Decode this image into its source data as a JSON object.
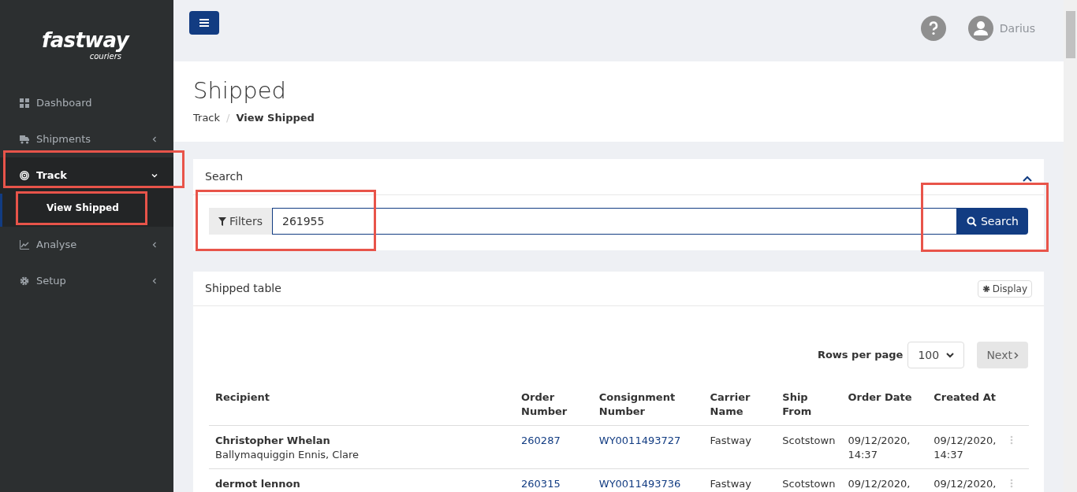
{
  "logo": {
    "name": "fastway",
    "tagline": "couriers"
  },
  "sidebar": {
    "items": [
      {
        "label": "Dashboard",
        "kind": "link",
        "selected": false
      },
      {
        "label": "Shipments",
        "kind": "menu",
        "expanded": false,
        "selected": false
      },
      {
        "label": "Track",
        "kind": "menu",
        "expanded": true,
        "selected": true,
        "children": [
          {
            "label": "View Shipped",
            "selected": true
          }
        ]
      },
      {
        "label": "Analyse",
        "kind": "menu",
        "expanded": false,
        "selected": false
      },
      {
        "label": "Setup",
        "kind": "menu",
        "expanded": false,
        "selected": false
      }
    ]
  },
  "header": {
    "user": "Darius"
  },
  "page": {
    "title": "Shipped",
    "breadcrumb_separator": "/",
    "breadcrumb": [
      {
        "label": "Track",
        "selected": false
      },
      {
        "label": "View Shipped",
        "selected": true
      }
    ]
  },
  "search": {
    "title": "Search",
    "filters_label": "Filters",
    "value": "261955",
    "button": "Search"
  },
  "table": {
    "title": "Shipped table",
    "display_button": "Display",
    "rows_per_page_label": "Rows per page",
    "rows_per_page": "100",
    "next_button": "Next",
    "columns": [
      [
        "Recipient"
      ],
      [
        "Order",
        "Number"
      ],
      [
        "Consignment",
        "Number"
      ],
      [
        "Carrier",
        "Name"
      ],
      [
        "Ship",
        "From"
      ],
      [
        "Order Date"
      ],
      [
        "Created At"
      ]
    ],
    "rows": [
      {
        "name": "Christopher Whelan",
        "address": "Ballymaquiggin Ennis, Clare",
        "order": "260287",
        "consignment": "WY0011493727",
        "carrier": "Fastway",
        "ship_from": "Scotstown",
        "order_date": [
          "09/12/2020,",
          "14:37"
        ],
        "created_at": [
          "09/12/2020,",
          "14:37"
        ]
      },
      {
        "name": "dermot lennon",
        "order": "260315",
        "consignment": "WY0011493736",
        "carrier": "Fastway",
        "ship_from": "Scotstown",
        "order_date": [
          "09/12/2020,"
        ],
        "created_at": [
          "09/12/2020,"
        ]
      }
    ]
  }
}
